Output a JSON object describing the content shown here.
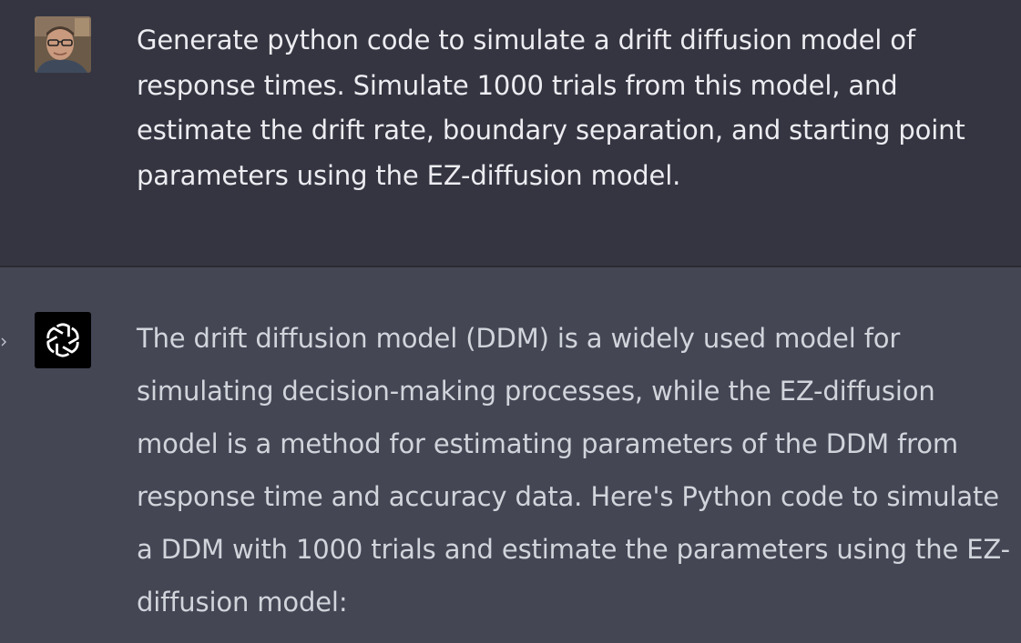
{
  "user_message": {
    "avatar_icon": "user-photo-avatar",
    "text": "Generate python code to simulate a drift diffusion model of response times. Simulate 1000 trials from this model, and estimate the drift rate, boundary separation, and starting point parameters using the EZ-diffusion model."
  },
  "assistant_message": {
    "avatar_icon": "openai-logo-icon",
    "expand_icon": "chevron-right-icon",
    "text": "The drift diffusion model (DDM) is a widely used model for simulating decision-making processes, while the EZ-diffusion model is a method for estimating parameters of the DDM from response time and accuracy data. Here's Python code to simulate a DDM with 1000 trials and estimate the parameters using the EZ-diffusion model:"
  },
  "colors": {
    "user_bg": "#343541",
    "assistant_bg": "#444654",
    "text": "#ececf1",
    "logo_bg": "#000000"
  }
}
